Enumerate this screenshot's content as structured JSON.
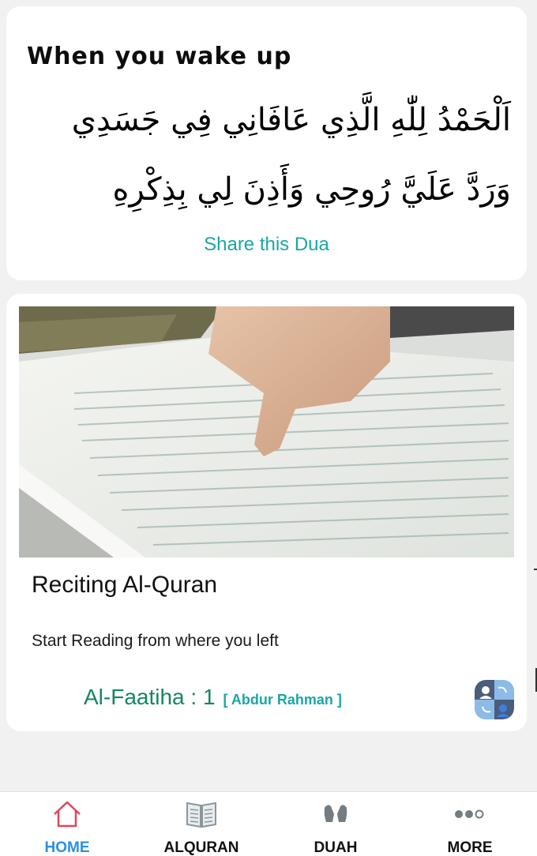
{
  "dua": {
    "title": "When you wake up",
    "arabic": "اَلْحَمْدُ لِلّٰهِ الَّذِي عَافَانِي فِي جَسَدِي وَرَدَّ عَلَيَّ رُوحِي وَأَذِنَ لِي بِذِكْرِهِ",
    "share_label": "Share this Dua"
  },
  "quran_card": {
    "title": "Reciting Al-Quran",
    "subtitle": "Start Reading from where you left",
    "last_read": "Al-Faatiha : 1",
    "reciter": "[ Abdur Rahman ]"
  },
  "nav": {
    "items": [
      {
        "label": "HOME",
        "icon": "home-icon",
        "active": true
      },
      {
        "label": "ALQURAN",
        "icon": "book-icon",
        "active": false
      },
      {
        "label": "DUAH",
        "icon": "praying-hands-icon",
        "active": false
      },
      {
        "label": "MORE",
        "icon": "more-icon",
        "active": false
      }
    ]
  },
  "colors": {
    "accent_teal": "#1aa6a6",
    "surah_green": "#13875e",
    "active_tab_blue": "#2b90e0",
    "home_icon_red": "#e0455a",
    "background": "#f1f1f2"
  }
}
